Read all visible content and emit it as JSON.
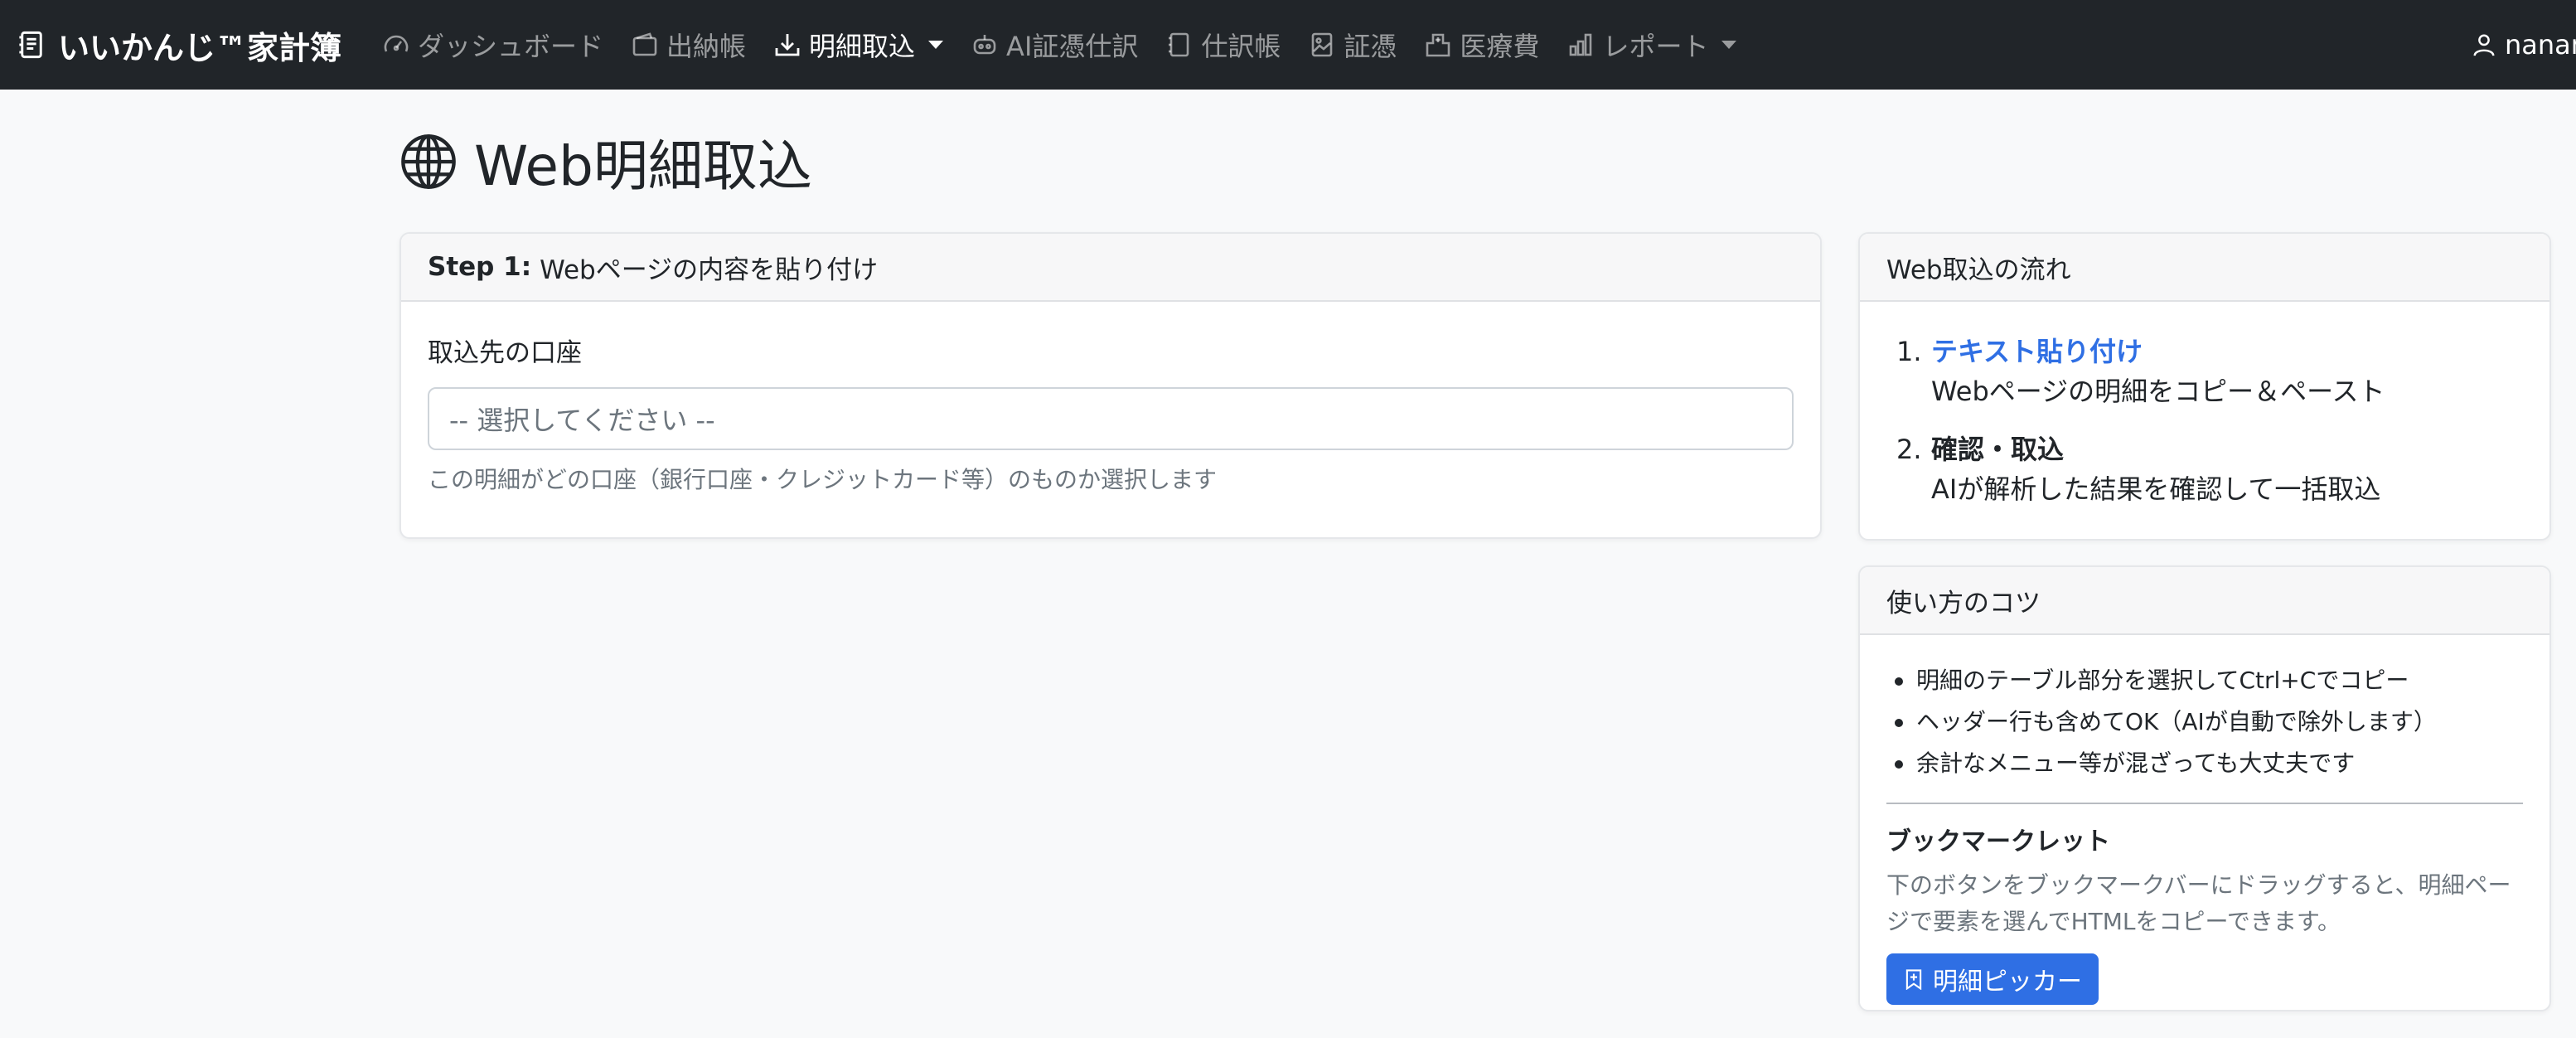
{
  "navbar": {
    "brand": "いいかんじ™家計簿",
    "items": [
      {
        "label": "ダッシュボード",
        "icon": "speedometer-icon"
      },
      {
        "label": "出納帳",
        "icon": "wallet-icon"
      },
      {
        "label": "明細取込",
        "icon": "download-icon",
        "active": true,
        "dropdown": true
      },
      {
        "label": "AI証憑仕訳",
        "icon": "robot-icon"
      },
      {
        "label": "仕訳帳",
        "icon": "journal-icon"
      },
      {
        "label": "証憑",
        "icon": "image-icon"
      },
      {
        "label": "医療費",
        "icon": "hospital-icon"
      },
      {
        "label": "レポート",
        "icon": "bar-chart-icon",
        "dropdown": true
      }
    ],
    "user": "nanan"
  },
  "page": {
    "title": "Web明細取込"
  },
  "step1": {
    "header_step": "Step 1:",
    "header_text": "Webページの内容を貼り付け",
    "account_label": "取込先の口座",
    "account_select": "-- 選択してください --",
    "account_help": "この明細がどの口座（銀行口座・クレジットカード等）のものか選択します"
  },
  "flow": {
    "header": "Web取込の流れ",
    "steps": [
      {
        "num": "1.",
        "title": "テキスト貼り付け",
        "desc": "Webページの明細をコピー＆ペースト"
      },
      {
        "num": "2.",
        "title": "確認・取込",
        "desc": "AIが解析した結果を確認して一括取込"
      }
    ]
  },
  "tips": {
    "header": "使い方のコツ",
    "items": [
      "明細のテーブル部分を選択してCtrl+Cでコピー",
      "ヘッダー行も含めてOK（AIが自動で除外します）",
      "余計なメニュー等が混ざっても大丈夫です"
    ],
    "bookmarklet_title": "ブックマークレット",
    "bookmarklet_desc": "下のボタンをブックマークバーにドラッグすると、明細ページで要素を選んでHTMLをコピーできます。",
    "bookmarklet_button": "明細ピッカー"
  },
  "colors": {
    "navbar_bg": "#212529",
    "accent": "#2f6fe4",
    "page_bg": "#f8f9fa"
  }
}
